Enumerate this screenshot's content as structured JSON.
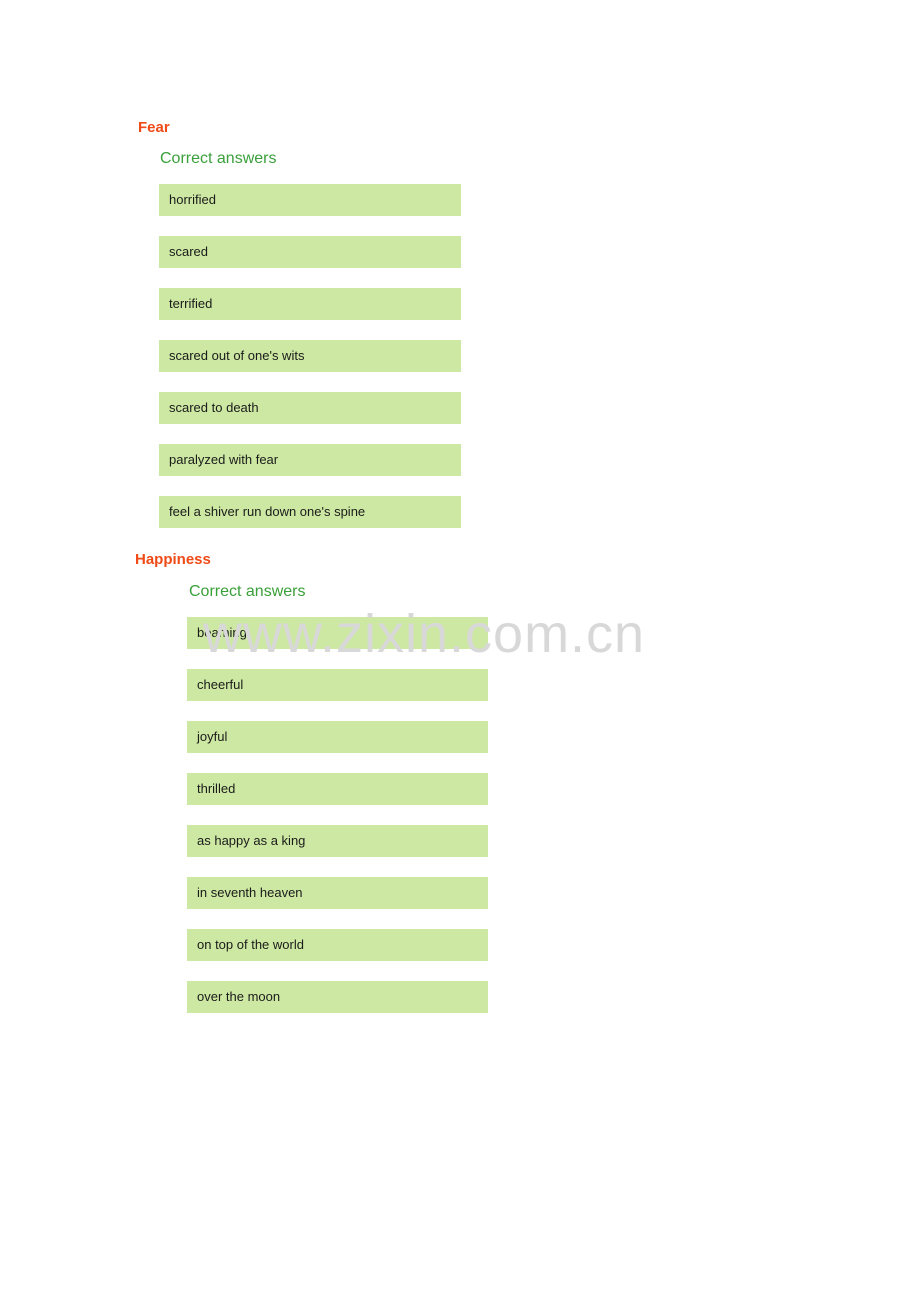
{
  "watermark": {
    "text": "www.zixin.com.cn"
  },
  "colors": {
    "section_title": "#ef4a17",
    "subsection_title": "#3aa03a",
    "answer_background": "#cce8a2",
    "answer_text": "#1b1b1b",
    "page_background": "#ffffff",
    "watermark": "#d8d8d8"
  },
  "sections": [
    {
      "title": "Fear",
      "subsection_title": "Correct answers",
      "answers": [
        "horrified",
        "scared",
        "terrified",
        "scared out of one's wits",
        "scared to death",
        "paralyzed with fear",
        "feel a shiver run down one's spine"
      ]
    },
    {
      "title": "Happiness",
      "subsection_title": "Correct answers",
      "answers": [
        "beaming",
        "cheerful",
        "joyful",
        "thrilled",
        "as happy as a king",
        "in seventh heaven",
        "on top of the world",
        "over the moon"
      ]
    }
  ]
}
